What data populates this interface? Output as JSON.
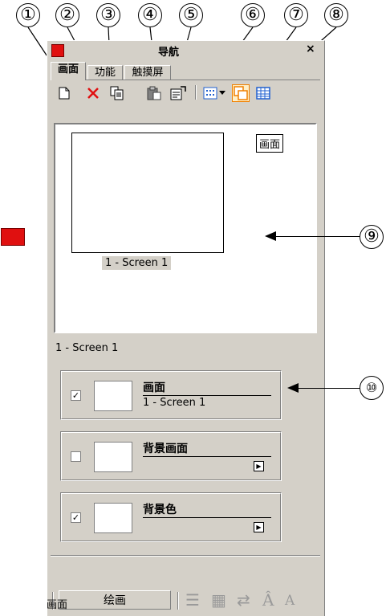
{
  "callouts": [
    "①",
    "②",
    "③",
    "④",
    "⑤",
    "⑥",
    "⑦",
    "⑧",
    "⑨",
    "⑩"
  ],
  "panel": {
    "title": "导航",
    "close": "×",
    "tabs": [
      {
        "label": "画面",
        "active": true
      },
      {
        "label": "功能",
        "active": false
      },
      {
        "label": "触摸屏",
        "active": false
      }
    ],
    "toolbar": {
      "icons": [
        "new-page-icon",
        "delete-icon",
        "copy-icon",
        "paste-icon",
        "properties-icon",
        "grid-view-icon",
        "dropdown-arrow-icon",
        "overlap-view-icon",
        "table-view-icon"
      ]
    },
    "preview": {
      "thumb_label": "1 - Screen 1",
      "view_button": "画面"
    },
    "current_screen": "1 - Screen 1",
    "layers": [
      {
        "name": "画面",
        "value": "1 - Screen 1",
        "checked": true
      },
      {
        "name": "背景画面",
        "value": "",
        "checked": false
      },
      {
        "name": "背景色",
        "value": "",
        "checked": true
      }
    ],
    "bottom": {
      "draw_button": "绘画"
    },
    "status": "画面"
  },
  "colors": {
    "panel_bg": "#d4d0c8",
    "accent_red": "#e01010",
    "toolbar_orange": "#f08000",
    "toolbar_blue": "#2060d0"
  }
}
